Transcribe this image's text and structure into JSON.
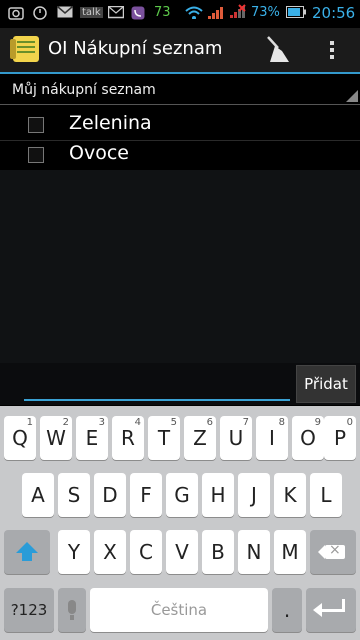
{
  "status_bar": {
    "notification_count": "73",
    "battery_percent": "73%",
    "time": "20:56",
    "talk_label": "talk"
  },
  "action_bar": {
    "title": "OI Nákupní seznam",
    "icons": [
      "app-icon",
      "broom-icon",
      "overflow-menu-icon"
    ]
  },
  "list_selector": {
    "selected": "Můj nákupní seznam"
  },
  "items": [
    {
      "label": "Zelenina",
      "checked": false
    },
    {
      "label": "Ovoce",
      "checked": false
    }
  ],
  "input": {
    "value": "",
    "add_label": "Přidat"
  },
  "keyboard": {
    "row1": [
      {
        "key": "Q",
        "hint": "1"
      },
      {
        "key": "W",
        "hint": "2"
      },
      {
        "key": "E",
        "hint": "3"
      },
      {
        "key": "R",
        "hint": "4"
      },
      {
        "key": "T",
        "hint": "5"
      },
      {
        "key": "Z",
        "hint": "6"
      },
      {
        "key": "U",
        "hint": "7"
      },
      {
        "key": "I",
        "hint": "8"
      },
      {
        "key": "O",
        "hint": "9"
      },
      {
        "key": "P",
        "hint": "0"
      }
    ],
    "row2": [
      "A",
      "S",
      "D",
      "F",
      "G",
      "H",
      "J",
      "K",
      "L"
    ],
    "row3": [
      "Y",
      "X",
      "C",
      "V",
      "B",
      "N",
      "M"
    ],
    "symbols_label": "?123",
    "space_label": "Čeština",
    "period_label": ".",
    "colors": {
      "accent": "#2a9cd8",
      "background": "#c8c9cb"
    }
  }
}
